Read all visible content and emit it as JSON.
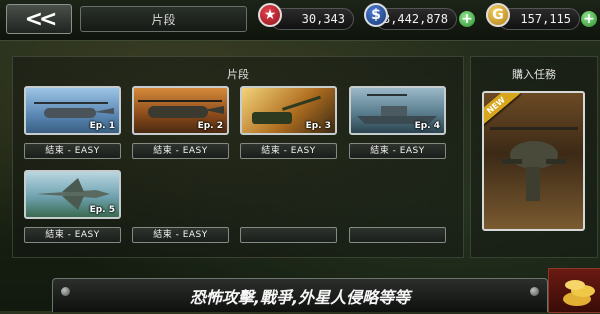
{
  "header": {
    "back_label": "<<",
    "section_title": "片段",
    "stars": "30,343",
    "dollars": "3,442,878",
    "gold": "157,115",
    "currency_icons": {
      "star": "★",
      "dollar": "$",
      "gold": "G",
      "plus": "+"
    }
  },
  "episodes_panel": {
    "title": "片段",
    "episodes": [
      {
        "ep_label": "Ep. 1",
        "status": "結束 - EASY"
      },
      {
        "ep_label": "Ep. 2",
        "status": "結束 - EASY"
      },
      {
        "ep_label": "Ep. 3",
        "status": "結束 - EASY"
      },
      {
        "ep_label": "Ep. 4",
        "status": "結束 - EASY"
      },
      {
        "ep_label": "Ep. 5",
        "status": "結束 - EASY"
      }
    ],
    "extra_status": [
      "結束 - EASY",
      "",
      ""
    ]
  },
  "side_panel": {
    "title": "購入任務",
    "badge": "NEW"
  },
  "banner": {
    "text": "恐怖攻擊,戰爭,外星人侵略等等"
  },
  "colors": {
    "star_icon": "#b0202a",
    "dollar_icon": "#1f4a8f",
    "gold_icon": "#d6a21f",
    "plus_icon": "#3aa83a"
  }
}
